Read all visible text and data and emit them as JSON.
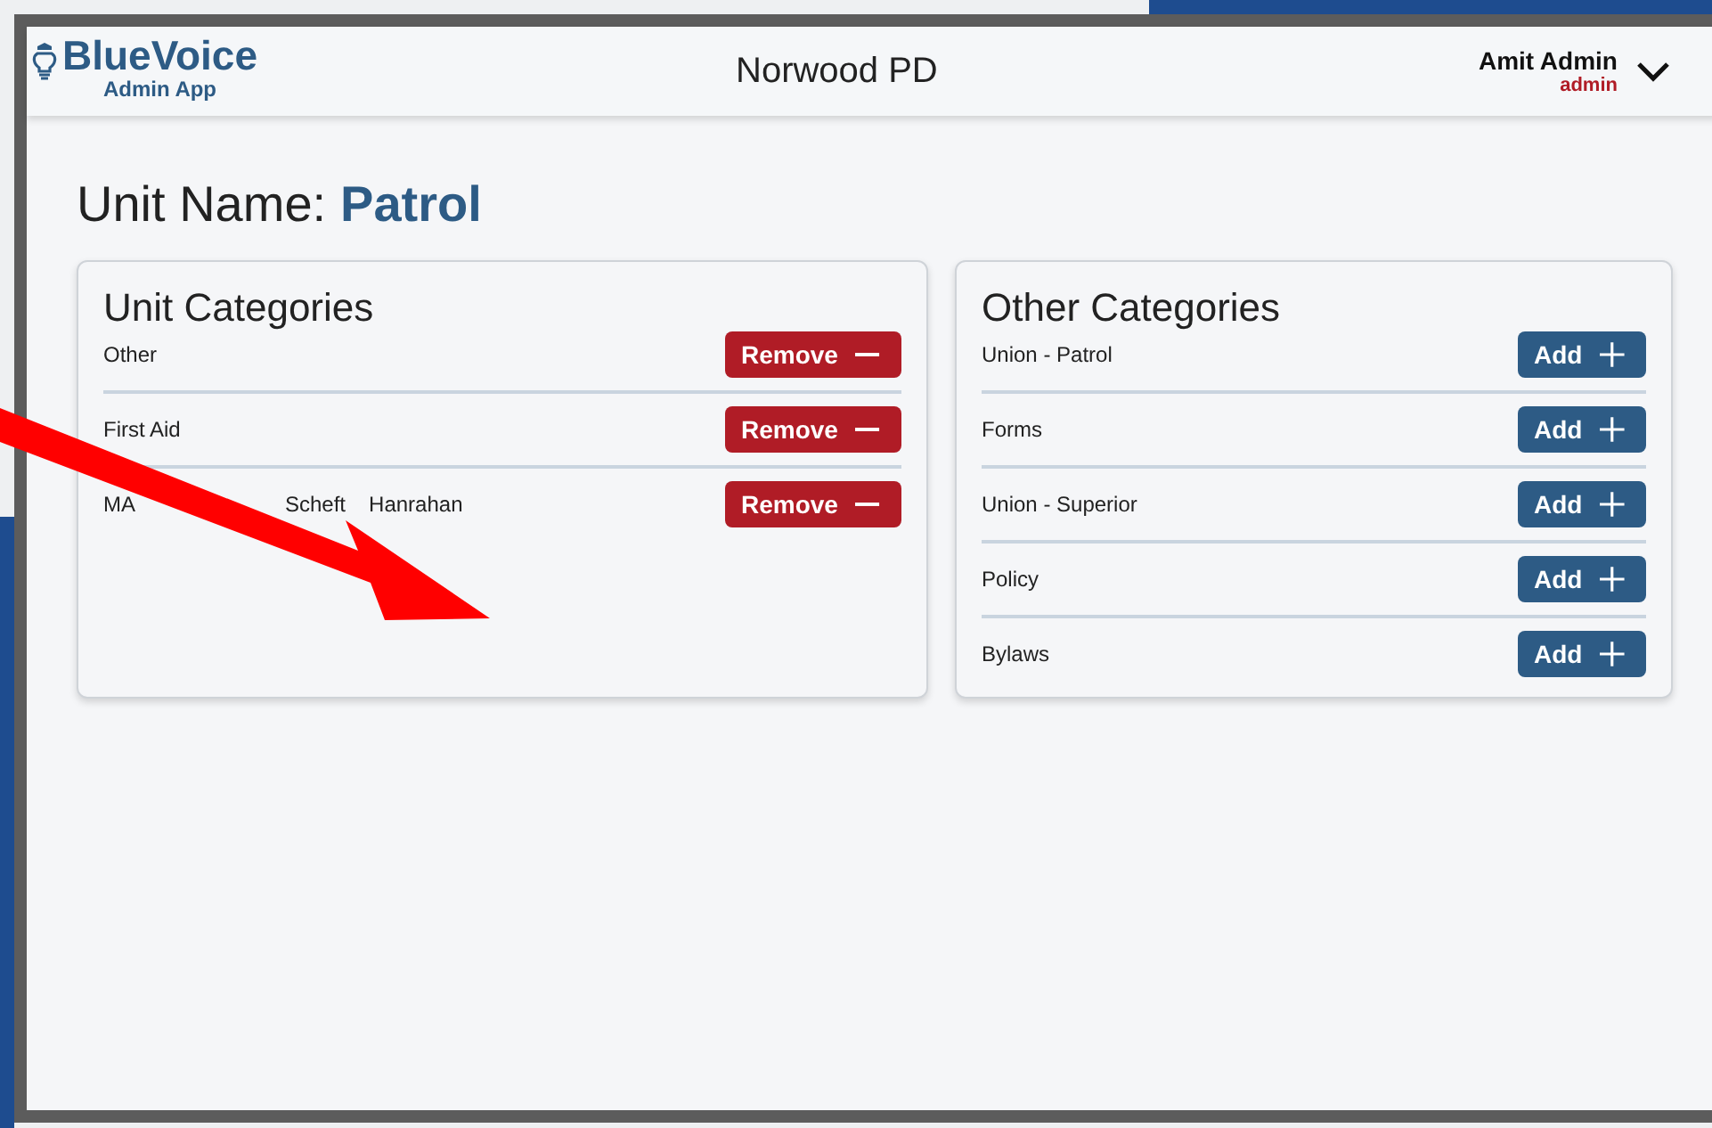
{
  "header": {
    "logo": {
      "name": "BlueVoice",
      "subtitle": "Admin App"
    },
    "title": "Norwood PD",
    "user": {
      "name": "Amit Admin",
      "role": "admin"
    }
  },
  "unit": {
    "label": "Unit Name:",
    "name": "Patrol"
  },
  "panels": [
    {
      "title": "Unit Categories",
      "kind": "minus",
      "items": [
        {
          "label": "Other",
          "button": "Remove"
        },
        {
          "label": "First Aid",
          "button": "Remove"
        },
        {
          "label_parts": [
            "MA",
            "Scheft",
            "Hanrahan"
          ],
          "button": "Remove"
        }
      ]
    },
    {
      "title": "Other Categories",
      "kind": "plus",
      "items": [
        {
          "label": "Union - Patrol",
          "button": "Add"
        },
        {
          "label": "Forms",
          "button": "Add"
        },
        {
          "label": "Union - Superior",
          "button": "Add"
        },
        {
          "label": "Policy",
          "button": "Add"
        },
        {
          "label": "Bylaws",
          "button": "Add"
        }
      ]
    }
  ]
}
